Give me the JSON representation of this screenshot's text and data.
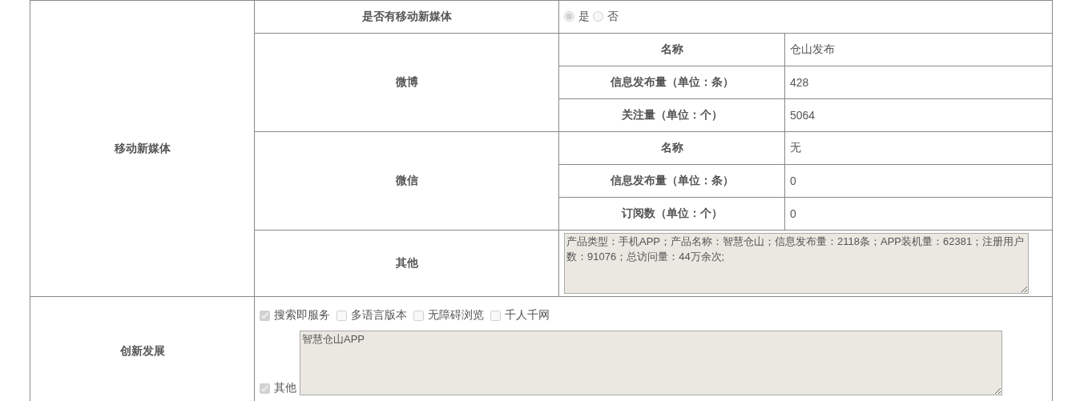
{
  "media": {
    "label": "移动新媒体",
    "question": {
      "label": "是否有移动新媒体",
      "options": [
        {
          "label": "是",
          "selected": true
        },
        {
          "label": "否",
          "selected": false
        }
      ]
    },
    "groups": [
      {
        "label": "微博",
        "fields": [
          {
            "label": "名称",
            "value": "仓山发布"
          },
          {
            "label": "信息发布量（单位：条）",
            "value": "428"
          },
          {
            "label": "关注量（单位：个）",
            "value": "5064"
          }
        ]
      },
      {
        "label": "微信",
        "fields": [
          {
            "label": "名称",
            "value": "无"
          },
          {
            "label": "信息发布量（单位：条）",
            "value": "0"
          },
          {
            "label": "订阅数（单位：个）",
            "value": "0"
          }
        ]
      }
    ],
    "other": {
      "label": "其他",
      "value": "产品类型：手机APP；产品名称：智慧仓山；信息发布量：2118条；APP装机量：62381；注册用户数：91076；总访问量：44万余次;"
    }
  },
  "innovation": {
    "label": "创新发展",
    "options": [
      {
        "label": "搜索即服务",
        "checked": true
      },
      {
        "label": "多语言版本",
        "checked": false
      },
      {
        "label": "无障碍浏览",
        "checked": false
      },
      {
        "label": "千人千网",
        "checked": false
      }
    ],
    "other": {
      "label": "其他",
      "checked": true,
      "value": "智慧仓山APP"
    }
  }
}
